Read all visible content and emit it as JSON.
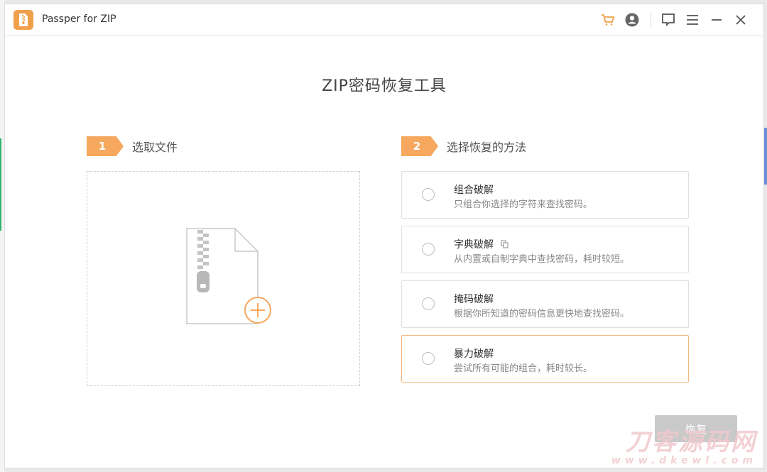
{
  "window": {
    "title": "Passper for ZIP"
  },
  "titlebar": {
    "icons": [
      "cart-icon",
      "account-icon",
      "feedback-icon",
      "menu-icon",
      "minimize-icon",
      "close-icon"
    ],
    "accent": "#f0a04b"
  },
  "main": {
    "title": "ZIP密码恢复工具"
  },
  "steps": [
    {
      "number": "1",
      "label": "选取文件"
    },
    {
      "number": "2",
      "label": "选择恢复的方法"
    }
  ],
  "methods": [
    {
      "title": "组合破解",
      "desc": "只组合你选择的字符来查找密码。",
      "selected": false
    },
    {
      "title": "字典破解",
      "desc": "从内置或自制字典中查找密码，耗时较短。",
      "selected": false
    },
    {
      "title": "掩码破解",
      "desc": "根据你所知道的密码信息更快地查找密码。",
      "selected": false
    },
    {
      "title": "暴力破解",
      "desc": "尝试所有可能的组合，耗时较长。",
      "selected": false
    }
  ],
  "actions": {
    "recover_label": "恢复"
  },
  "watermark": {
    "line1": "刀客源码网",
    "line2": "www.dkewl.com"
  },
  "colors": {
    "accent": "#f5a85e",
    "button_disabled": "#c9c9c9",
    "selected_border": "#f5b880"
  }
}
